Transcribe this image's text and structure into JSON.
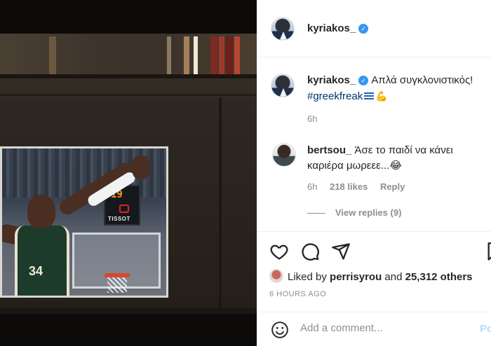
{
  "post": {
    "author": "kyriakos_",
    "verified": true,
    "caption_text": "Απλά συγκλονιστικός!",
    "hashtag": "#greekfreak",
    "caption_time": "6h"
  },
  "photo": {
    "scoreboard_number": "19",
    "scoreboard_brand": "TISSOT",
    "jersey_number": "34"
  },
  "comment": {
    "author": "bertsou_",
    "text": "Άσε το παιδί να κάνει καριέρα μωρεεε...😂",
    "time": "6h",
    "likes": "218 likes",
    "reply_label": "Reply",
    "view_replies": "View replies (9)"
  },
  "engagement": {
    "liked_by_prefix": "Liked by",
    "liked_by_user": "perrisyrou",
    "liked_by_and": "and",
    "liked_by_others": "25,312 others",
    "post_time": "6 HOURS AGO"
  },
  "add_comment": {
    "placeholder": "Add a comment...",
    "post_label": "Po"
  },
  "colors": {
    "verified_badge": "#3897f0",
    "hashtag": "#00376b",
    "muted_text": "#8e8e8e",
    "post_button_disabled": "#b2dffc"
  },
  "icons": [
    "heart-icon",
    "comment-icon",
    "share-icon",
    "bookmark-icon",
    "emoji-icon",
    "verified-icon"
  ]
}
